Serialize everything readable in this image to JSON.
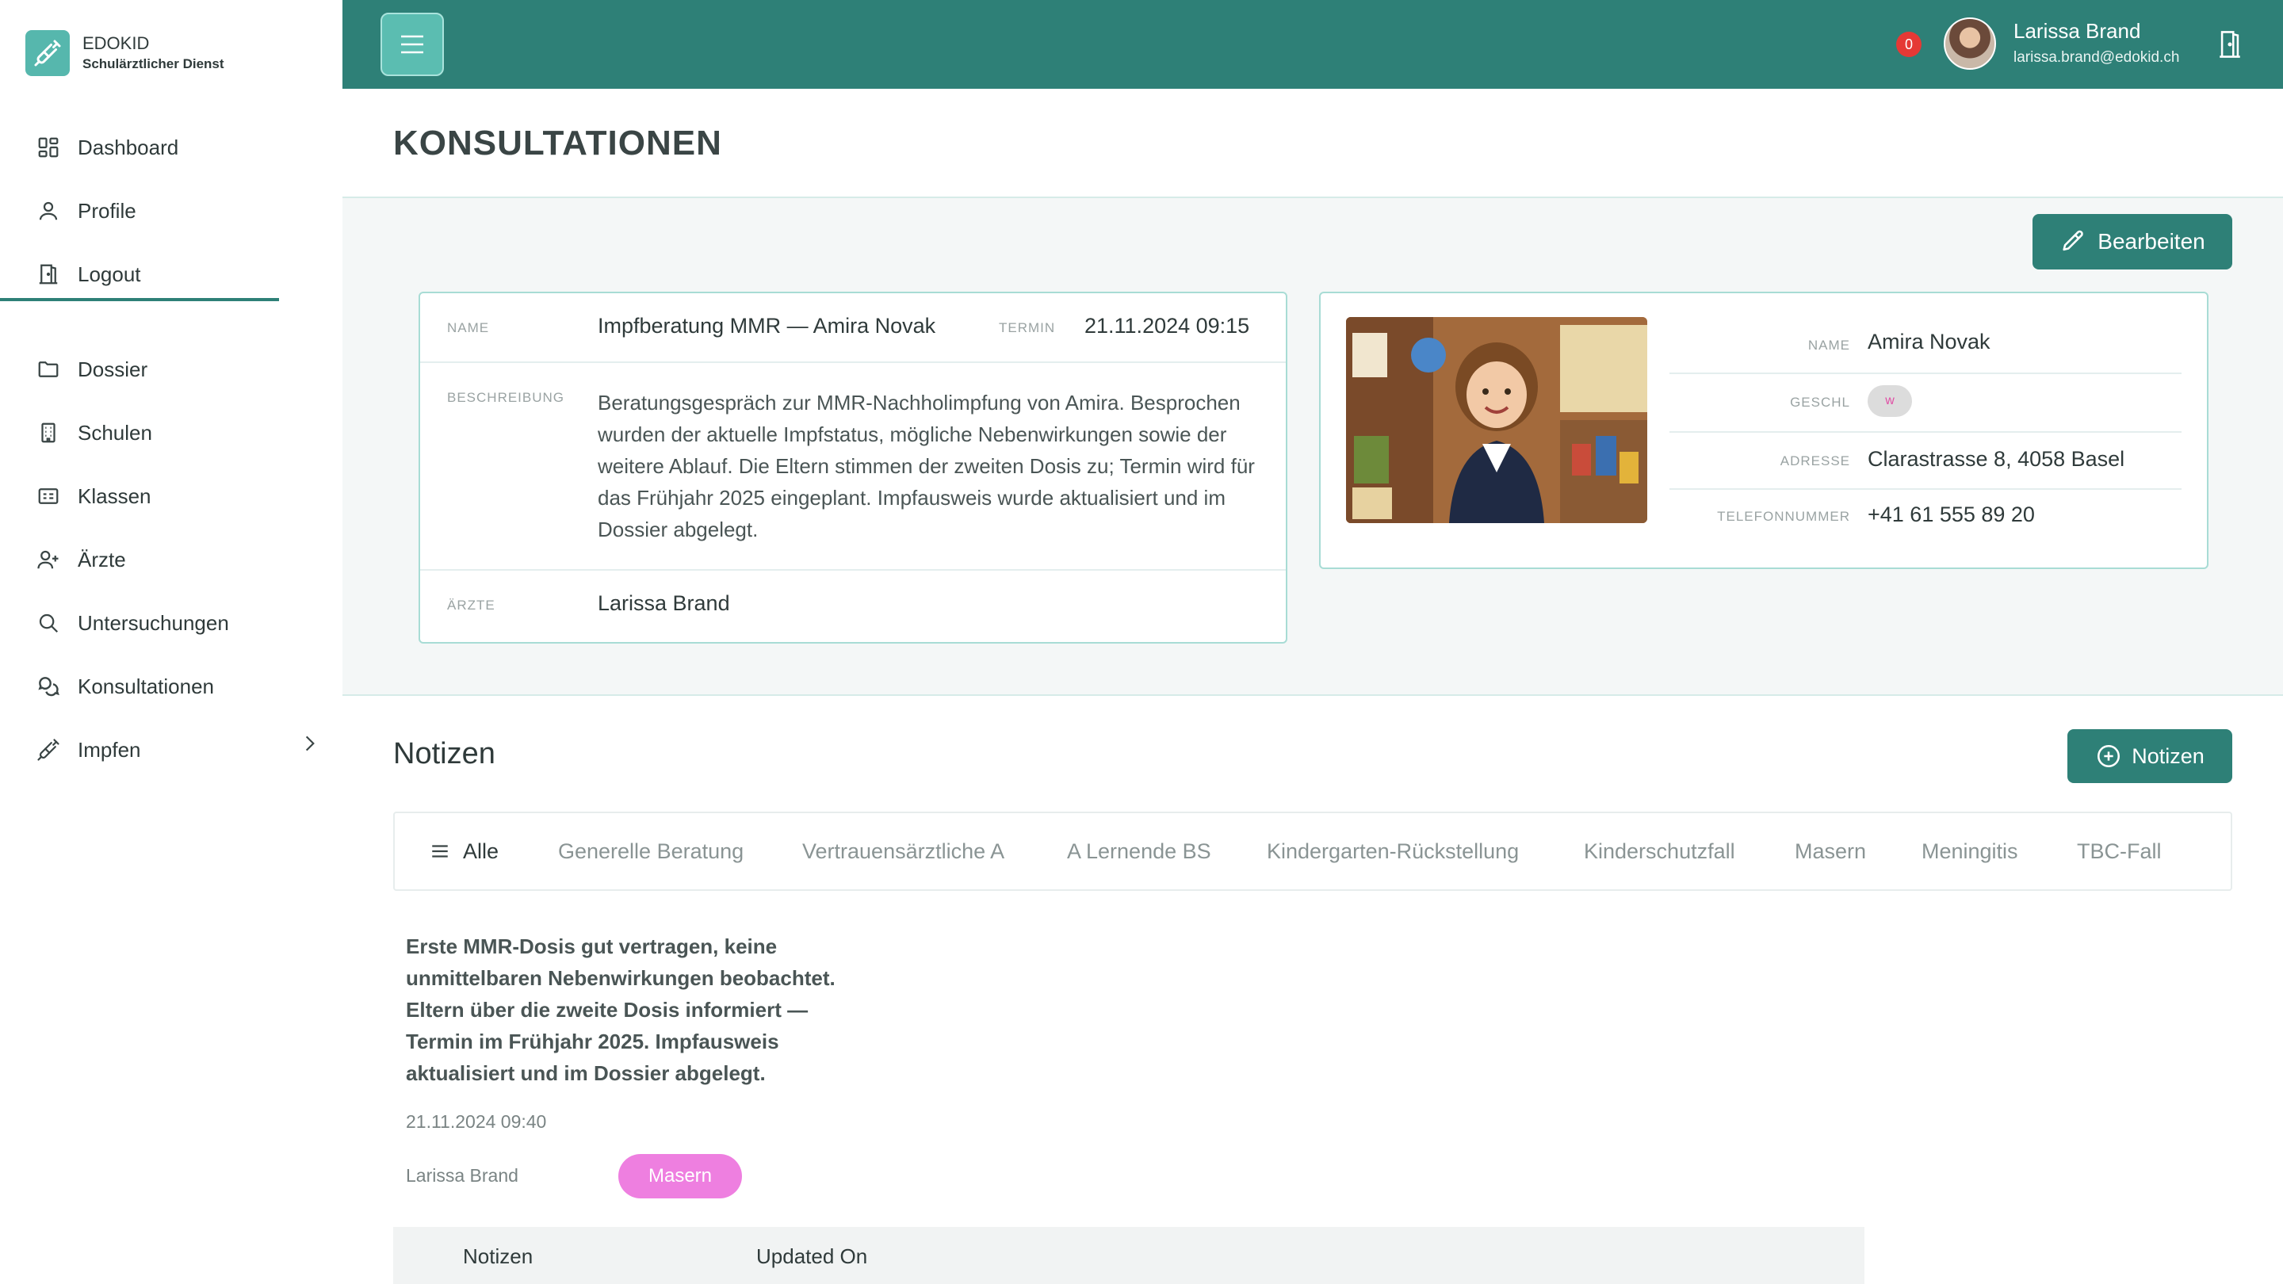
{
  "brand": {
    "name": "EDOKID",
    "subtitle": "Schulärztlicher Dienst",
    "icon": "syringe-icon"
  },
  "sidebar": {
    "items": [
      {
        "label": "Dashboard",
        "icon": "dashboard-icon"
      },
      {
        "label": "Profile",
        "icon": "user-icon"
      },
      {
        "label": "Logout",
        "icon": "door-icon"
      },
      {
        "label": "Dossier",
        "icon": "folder-icon"
      },
      {
        "label": "Schulen",
        "icon": "building-icon"
      },
      {
        "label": "Klassen",
        "icon": "id-card-icon"
      },
      {
        "label": "Ärzte",
        "icon": "user-plus-icon"
      },
      {
        "label": "Untersuchungen",
        "icon": "search-icon"
      },
      {
        "label": "Konsultationen",
        "icon": "chat-icon"
      },
      {
        "label": "Impfen",
        "icon": "syringe-icon"
      }
    ]
  },
  "topbar": {
    "notification_count": "0",
    "user_name": "Larissa Brand",
    "user_email": "larissa.brand@edokid.ch"
  },
  "page": {
    "title": "KONSULTATIONEN",
    "edit_label": "Bearbeiten"
  },
  "consultation": {
    "name_label": "NAME",
    "name": "Impfberatung MMR — Amira Novak",
    "termin_label": "TERMIN",
    "termin": "21.11.2024 09:15",
    "desc_label": "BESCHREIBUNG",
    "description": "Beratungsgespräch zur MMR-Nachholimpfung von Amira. Besprochen wurden der aktuelle Impfstatus, mögliche Nebenwirkungen sowie der weitere Ablauf. Die Eltern stimmen der zweiten Dosis zu; Termin wird für das Frühjahr 2025 eingeplant. Impfausweis wurde aktualisiert und im Dossier abgelegt.",
    "aerzte_label": "ÄRZTE",
    "aerzte": "Larissa Brand"
  },
  "patient": {
    "name_label": "NAME",
    "name": "Amira Novak",
    "geschl_label": "GESCHL",
    "geschl": "w",
    "adresse_label": "ADRESSE",
    "adresse": "Clarastrasse 8, 4058 Basel",
    "telefon_label": "TELEFONNUMMER",
    "telefon": "+41 61 555 89 20"
  },
  "notes": {
    "title": "Notizen",
    "add_label": "Notizen",
    "tabs": [
      "Alle",
      "Generelle Beratung",
      "Vertrauensärztliche A",
      "A Lernende BS",
      "Kindergarten-Rückstellung",
      "Kinderschutzfall",
      "Masern",
      "Meningitis",
      "TBC-Fall"
    ],
    "item": {
      "text": "Erste MMR-Dosis gut vertragen, keine unmittelbaren Nebenwirkungen beobachtet. Eltern über die zweite Dosis informiert — Termin im Frühjahr 2025. Impfausweis aktualisiert und im Dossier abgelegt.",
      "date": "21.11.2024 09:40",
      "author": "Larissa Brand",
      "tag": "Masern"
    },
    "table_headers": [
      "Notizen",
      "Updated On"
    ]
  },
  "colors": {
    "primary": "#2e8077",
    "accent": "#56b7ad",
    "tag": "#ee7fe0",
    "badge": "#e53935"
  }
}
